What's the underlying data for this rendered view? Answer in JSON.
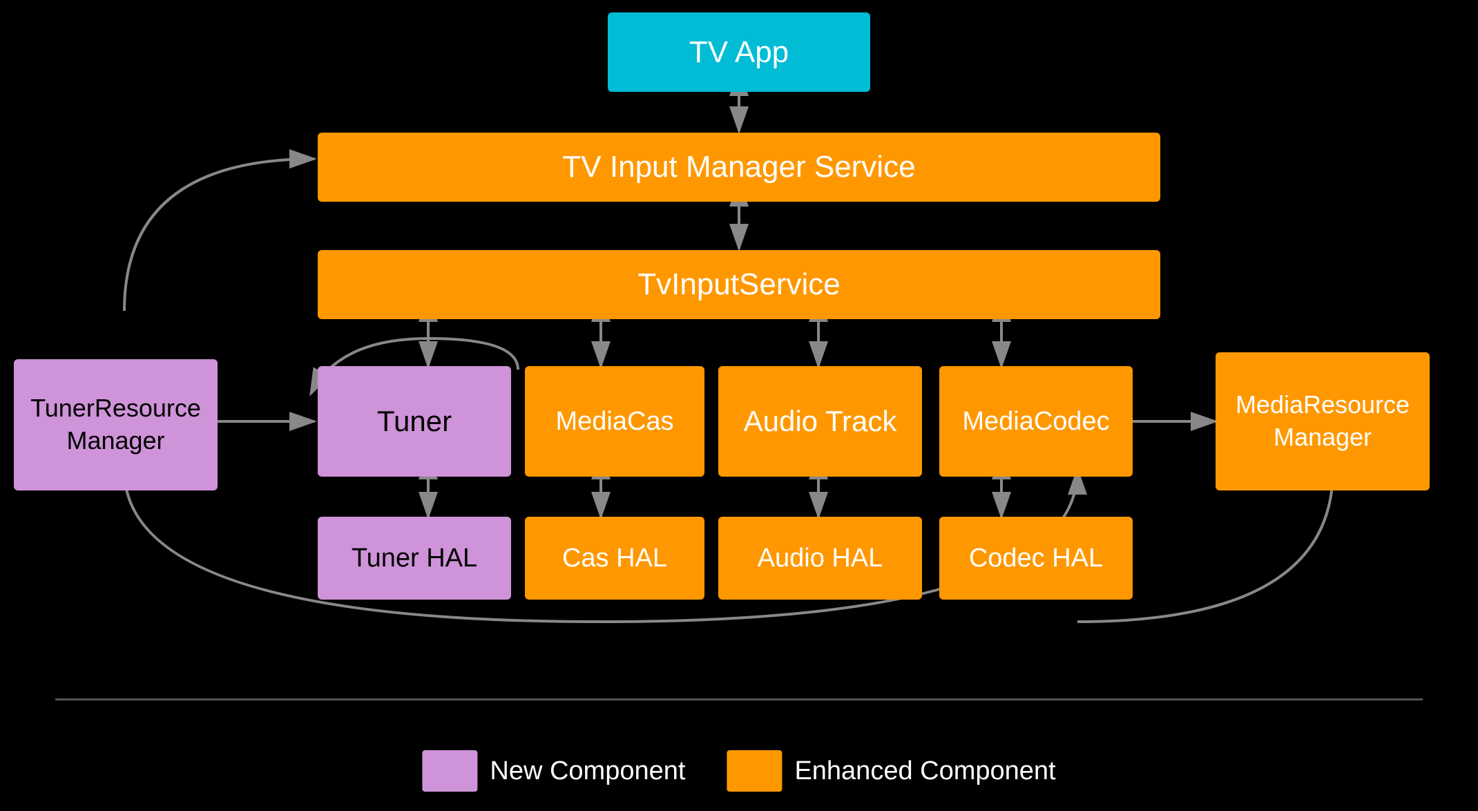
{
  "colors": {
    "orange": "#FF9800",
    "purple": "#CE93D8",
    "cyan": "#00BCD4",
    "arrow": "#888",
    "bg": "#000"
  },
  "boxes": {
    "tv_app": {
      "label": "TV App"
    },
    "tv_input_manager": {
      "label": "TV Input Manager Service"
    },
    "tv_input_service": {
      "label": "TvInputService"
    },
    "tuner_resource_manager": {
      "label": "TunerResource\nManager"
    },
    "tuner": {
      "label": "Tuner"
    },
    "media_cas": {
      "label": "MediaCas"
    },
    "audio_track": {
      "label": "Audio Track"
    },
    "media_codec": {
      "label": "MediaCodec"
    },
    "media_resource_manager": {
      "label": "MediaResource\nManager"
    },
    "tuner_hal": {
      "label": "Tuner HAL"
    },
    "cas_hal": {
      "label": "Cas HAL"
    },
    "audio_hal": {
      "label": "Audio HAL"
    },
    "codec_hal": {
      "label": "Codec HAL"
    }
  },
  "legend": {
    "new_component": "New Component",
    "enhanced_component": "Enhanced Component"
  }
}
